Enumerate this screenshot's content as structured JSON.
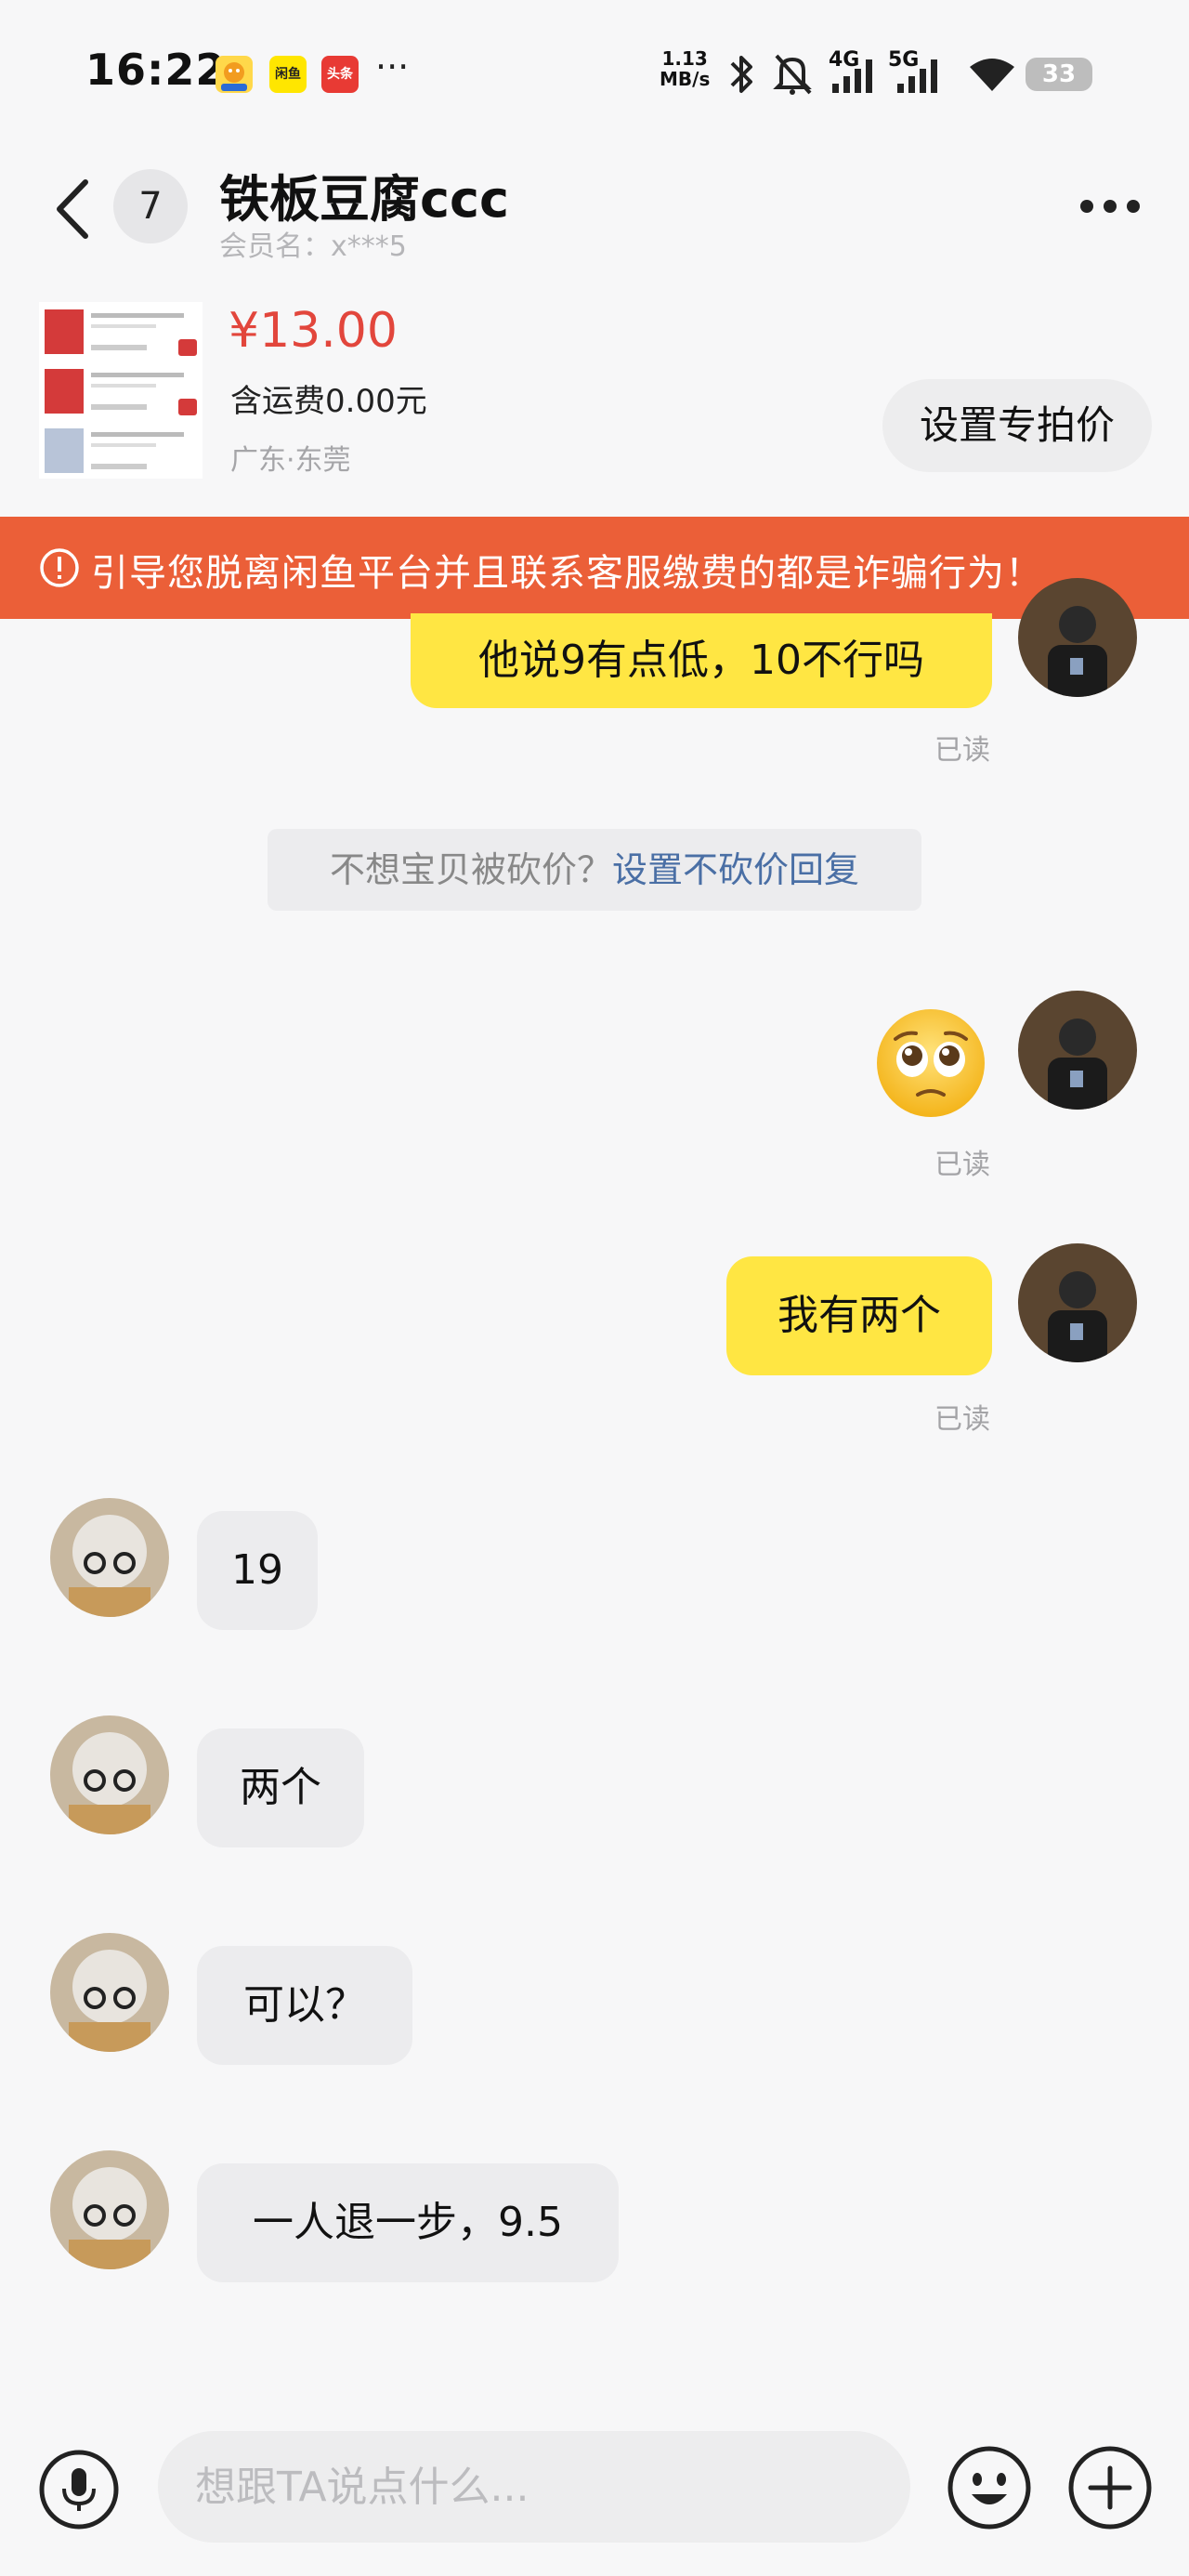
{
  "status_bar": {
    "time": "16:22",
    "app_icons": [
      "app-badge-1",
      "闲鱼",
      "头条"
    ],
    "more": "···",
    "net_speed_value": "1.13",
    "net_speed_unit": "MB/s",
    "signal_4g": "4G",
    "signal_5g": "5G",
    "battery": "33"
  },
  "header": {
    "unread_count": "7",
    "title": "铁板豆腐ccc",
    "member_name": "会员名：x***5"
  },
  "product": {
    "price": "¥13.00",
    "shipping": "含运费0.00元",
    "location": "广东·东莞",
    "special_price_button": "设置专拍价"
  },
  "warning": {
    "text": "引导您脱离闲鱼平台并且联系客服缴费的都是诈骗行为！"
  },
  "messages": [
    {
      "side": "out",
      "text": "他说9有点低，10不行吗",
      "read": "已读"
    },
    {
      "side": "system",
      "text": "不想宝贝被砍价？",
      "link": "设置不砍价回复"
    },
    {
      "side": "out",
      "emoji": "pleading-face",
      "read": "已读"
    },
    {
      "side": "out",
      "text": "我有两个",
      "read": "已读"
    },
    {
      "side": "in",
      "text": "19"
    },
    {
      "side": "in",
      "text": "两个"
    },
    {
      "side": "in",
      "text": "可以？"
    },
    {
      "side": "in",
      "text": "一人退一步，9.5"
    }
  ],
  "input": {
    "placeholder": "想跟TA说点什么..."
  },
  "colors": {
    "accent_yellow": "#ffe643",
    "warning_orange": "#eb5f38",
    "price_red": "#e2463c",
    "link_blue": "#4a6fa5"
  }
}
